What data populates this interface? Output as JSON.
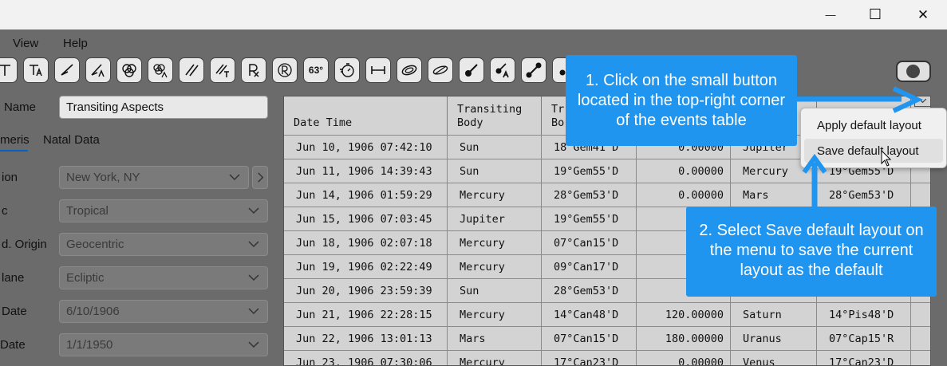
{
  "window": {
    "minimize_glyph": "—",
    "maximize_glyph": "☐",
    "close_glyph": "✕"
  },
  "menu": {
    "view": "View",
    "help": "Help"
  },
  "toolbar": {
    "degree_button": "63°"
  },
  "form": {
    "name_label": "Name",
    "name_value": "Transiting Aspects",
    "tab_ephemeris": "meris",
    "tab_natal": "Natal Data",
    "location_label": "ion",
    "location_value": "New York, NY",
    "zodiac_label": "c",
    "zodiac_value": "Tropical",
    "origin_label": "d. Origin",
    "origin_value": "Geocentric",
    "plane_label": "lane",
    "plane_value": "Ecliptic",
    "start_date_label": "Date",
    "start_date_value": "6/10/1906",
    "end_date_label": "Date",
    "end_date_value": "1/1/1950"
  },
  "table": {
    "headers": [
      "Date Time",
      "Transiting\nBody",
      "Tr\nBo",
      "",
      "",
      "dy",
      ""
    ],
    "rows": [
      [
        "Jun 10, 1906 07:42:10",
        "Sun",
        "18°Gem41'D",
        "0.00000",
        "Jupiter",
        "",
        ""
      ],
      [
        "Jun 11, 1906 14:39:43",
        "Sun",
        "19°Gem55'D",
        "0.00000",
        "Mercury",
        "19°Gem55'D",
        ""
      ],
      [
        "Jun 14, 1906 01:59:29",
        "Mercury",
        "28°Gem53'D",
        "0.00000",
        "Mars",
        "28°Gem53'D",
        ""
      ],
      [
        "Jun 15, 1906 07:03:45",
        "Jupiter",
        "19°Gem55'D",
        "0.0",
        "",
        "",
        ""
      ],
      [
        "Jun 18, 1906 02:07:18",
        "Mercury",
        "07°Can15'D",
        "180.0",
        "",
        "",
        ""
      ],
      [
        "Jun 19, 1906 02:22:49",
        "Mercury",
        "09°Can17'D",
        "0.0",
        "",
        "",
        ""
      ],
      [
        "Jun 20, 1906 23:59:39",
        "Sun",
        "28°Gem53'D",
        "0.0",
        "",
        "",
        ""
      ],
      [
        "Jun 21, 1906 22:28:15",
        "Mercury",
        "14°Can48'D",
        "120.00000",
        "Saturn",
        "14°Pis48'D",
        ""
      ],
      [
        "Jun 22, 1906 13:01:13",
        "Mars",
        "07°Can15'D",
        "180.00000",
        "Uranus",
        "07°Cap15'R",
        ""
      ],
      [
        "Jun 23, 1906 07:30:06",
        "Mercury",
        "17°Can23'D",
        "0.00000",
        "Venus",
        "17°Can23'D",
        ""
      ]
    ]
  },
  "context_menu": {
    "apply": "Apply default layout",
    "save": "Save default layout"
  },
  "callouts": {
    "step1": "1. Click on the small button located in the top-right corner of the events table",
    "step2": "2. Select Save default layout on the menu to save the current layout as the default"
  },
  "colors": {
    "callout": "#2095f0",
    "arrow": "#2095f0"
  }
}
